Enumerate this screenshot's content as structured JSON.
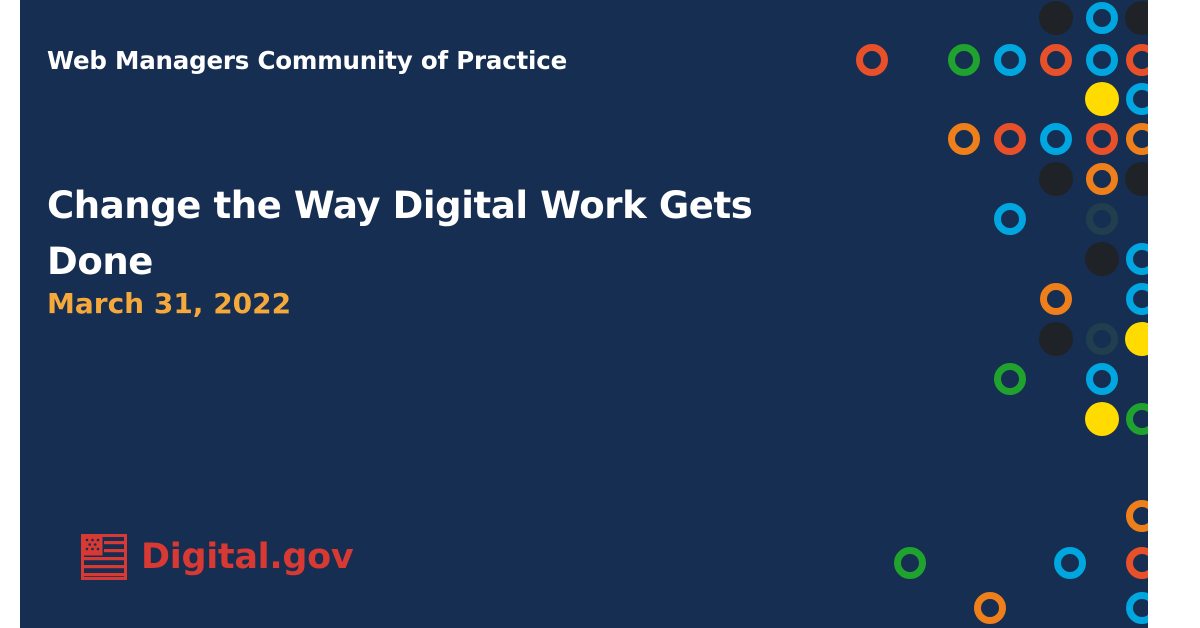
{
  "community_title": "Web Managers Community of Practice",
  "event_title": "Change the Way Digital Work Gets Done",
  "event_date": "March 31, 2022",
  "logo": {
    "text": "Digital.gov",
    "icon": "us-flag-icon"
  },
  "colors": {
    "background": "#162e51",
    "date": "#f6a93b",
    "logo": "#d83933",
    "dot_orange": "#ef7f1a",
    "dot_red": "#e8502a",
    "dot_blue": "#00a6e0",
    "dot_green": "#1fa22e",
    "dot_yellow": "#ffdb00",
    "dot_black": "#1f2226",
    "dot_teal": "#213e4e"
  }
}
